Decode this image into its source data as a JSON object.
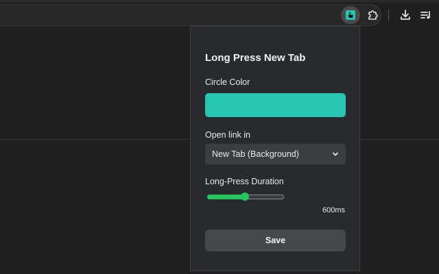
{
  "toolbar": {
    "extension_icon": "pointing-hand-icon",
    "puzzle_icon": "puzzle-icon",
    "download_icon": "download-icon",
    "media_icon": "media-queue-icon"
  },
  "popup": {
    "title": "Long Press New Tab",
    "circle_color_label": "Circle Color",
    "circle_color": "#26c6b0",
    "open_link_label": "Open link in",
    "open_link_value": "New Tab (Background)",
    "duration_label": "Long-Press Duration",
    "duration_fraction": 0.5,
    "duration_value": "600ms",
    "save_label": "Save"
  },
  "colors": {
    "accent": "#22c55e",
    "ext_icon": "#26c6b0"
  }
}
